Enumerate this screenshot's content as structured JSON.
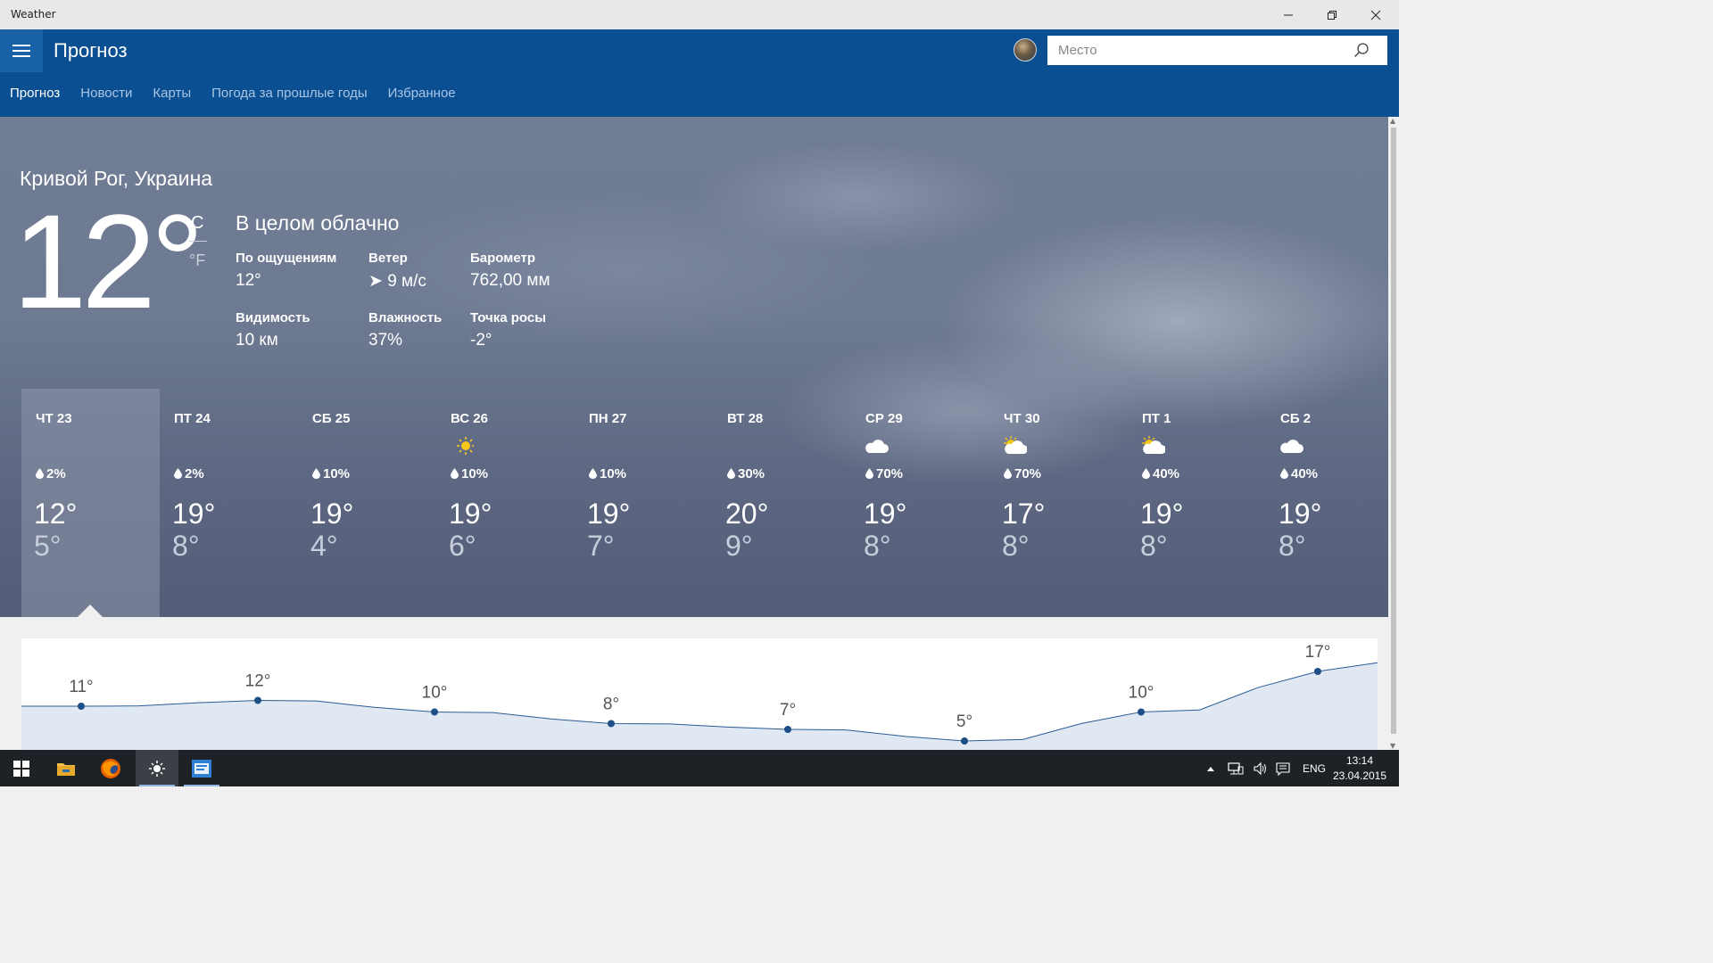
{
  "window": {
    "title": "Weather",
    "minimize_icon": "minimize-icon",
    "restore_icon": "restore-icon",
    "close_icon": "close-icon"
  },
  "header": {
    "menu_icon": "hamburger-icon",
    "title": "Прогноз",
    "search": {
      "placeholder": "Место",
      "value": "",
      "icon": "search-icon"
    },
    "nav": [
      {
        "label": "Прогноз",
        "active": true
      },
      {
        "label": "Новости",
        "active": false
      },
      {
        "label": "Карты",
        "active": false
      },
      {
        "label": "Погода за прошлые годы",
        "active": false
      },
      {
        "label": "Избранное",
        "active": false
      }
    ]
  },
  "current": {
    "location": "Кривой Рог, Украина",
    "temp": "12°",
    "unit_c": "C",
    "unit_f": "°F",
    "condition": "В целом облачно",
    "details": [
      {
        "label": "По ощущениям",
        "value": "12°"
      },
      {
        "label": "Ветер",
        "value": "➤ 9 м/с"
      },
      {
        "label": "Барометр",
        "value": "762,00 мм"
      },
      {
        "label": "Видимость",
        "value": "10 км"
      },
      {
        "label": "Влажность",
        "value": "37%"
      },
      {
        "label": "Точка росы",
        "value": "-2°"
      }
    ]
  },
  "forecast": [
    {
      "day": "ЧТ 23",
      "icon": "",
      "precip": "2%",
      "hi": "12°",
      "lo": "5°",
      "selected": true
    },
    {
      "day": "ПТ 24",
      "icon": "",
      "precip": "2%",
      "hi": "19°",
      "lo": "8°",
      "selected": false
    },
    {
      "day": "СБ 25",
      "icon": "",
      "precip": "10%",
      "hi": "19°",
      "lo": "4°",
      "selected": false
    },
    {
      "day": "ВС 26",
      "icon": "sun-icon",
      "precip": "10%",
      "hi": "19°",
      "lo": "6°",
      "selected": false
    },
    {
      "day": "ПН 27",
      "icon": "",
      "precip": "10%",
      "hi": "19°",
      "lo": "7°",
      "selected": false
    },
    {
      "day": "ВТ 28",
      "icon": "",
      "precip": "30%",
      "hi": "20°",
      "lo": "9°",
      "selected": false
    },
    {
      "day": "СР 29",
      "icon": "cloud-icon",
      "precip": "70%",
      "hi": "19°",
      "lo": "8°",
      "selected": false
    },
    {
      "day": "ЧТ 30",
      "icon": "partly-sunny-icon",
      "precip": "70%",
      "hi": "17°",
      "lo": "8°",
      "selected": false
    },
    {
      "day": "ПТ 1",
      "icon": "partly-sunny-icon",
      "precip": "40%",
      "hi": "19°",
      "lo": "8°",
      "selected": false
    },
    {
      "day": "СБ 2",
      "icon": "cloud-icon",
      "precip": "40%",
      "hi": "19°",
      "lo": "8°",
      "selected": false
    }
  ],
  "chart_data": {
    "type": "area",
    "x": [
      0,
      1,
      2,
      3,
      4,
      5,
      6,
      7
    ],
    "values": [
      11,
      12,
      10,
      8,
      7,
      5,
      10,
      17
    ],
    "labels": [
      "11°",
      "12°",
      "10°",
      "8°",
      "7°",
      "5°",
      "10°",
      "17°"
    ],
    "line_color": "#2a5d93",
    "fill_color": "#dfe8f3"
  },
  "taskbar": {
    "apps": [
      {
        "name": "start-icon"
      },
      {
        "name": "file-explorer-icon"
      },
      {
        "name": "firefox-icon"
      },
      {
        "name": "weather-app-icon"
      },
      {
        "name": "window-app-icon"
      }
    ],
    "tray": {
      "language": "ENG",
      "time": "13:14",
      "date": "23.04.2015"
    }
  }
}
